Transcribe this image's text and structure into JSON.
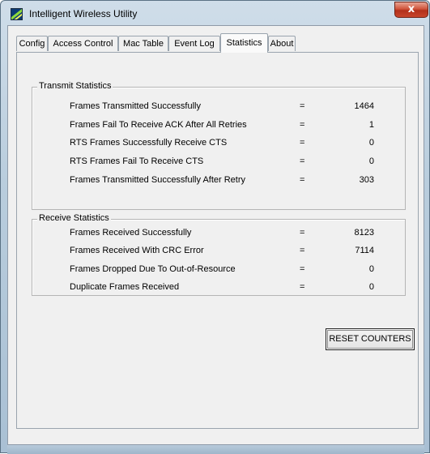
{
  "window": {
    "title": "Intelligent Wireless Utility",
    "close_glyph": "x"
  },
  "tabs": [
    {
      "label": "Config",
      "active": false
    },
    {
      "label": "Access Control",
      "active": false
    },
    {
      "label": "Mac Table",
      "active": false
    },
    {
      "label": "Event Log",
      "active": false
    },
    {
      "label": "Statistics",
      "active": true
    },
    {
      "label": "About",
      "active": false
    }
  ],
  "transmit": {
    "title": "Transmit Statistics",
    "rows": [
      {
        "label": "Frames Transmitted Successfully",
        "eq": "=",
        "value": "1464"
      },
      {
        "label": "Frames Fail To Receive ACK After All Retries",
        "eq": "=",
        "value": "1"
      },
      {
        "label": "RTS Frames Successfully Receive CTS",
        "eq": "=",
        "value": "0"
      },
      {
        "label": "RTS Frames Fail To Receive CTS",
        "eq": "=",
        "value": "0"
      },
      {
        "label": "Frames Transmitted Successfully After Retry",
        "eq": "=",
        "value": "303"
      }
    ]
  },
  "receive": {
    "title": "Receive Statistics",
    "rows": [
      {
        "label": "Frames Received Successfully",
        "eq": "=",
        "value": "8123"
      },
      {
        "label": "Frames Received With CRC Error",
        "eq": "=",
        "value": "7114"
      },
      {
        "label": "Frames Dropped Due To Out-of-Resource",
        "eq": "=",
        "value": "0"
      },
      {
        "label": "Duplicate Frames Received",
        "eq": "=",
        "value": "0"
      }
    ]
  },
  "buttons": {
    "reset": "RESET COUNTERS"
  },
  "icons": {
    "app": "wireless-app-icon",
    "close": "close-icon"
  },
  "colors": {
    "close_button": "#c8452b",
    "window_frame": "#b9cddd",
    "panel": "#f0f0f0"
  }
}
